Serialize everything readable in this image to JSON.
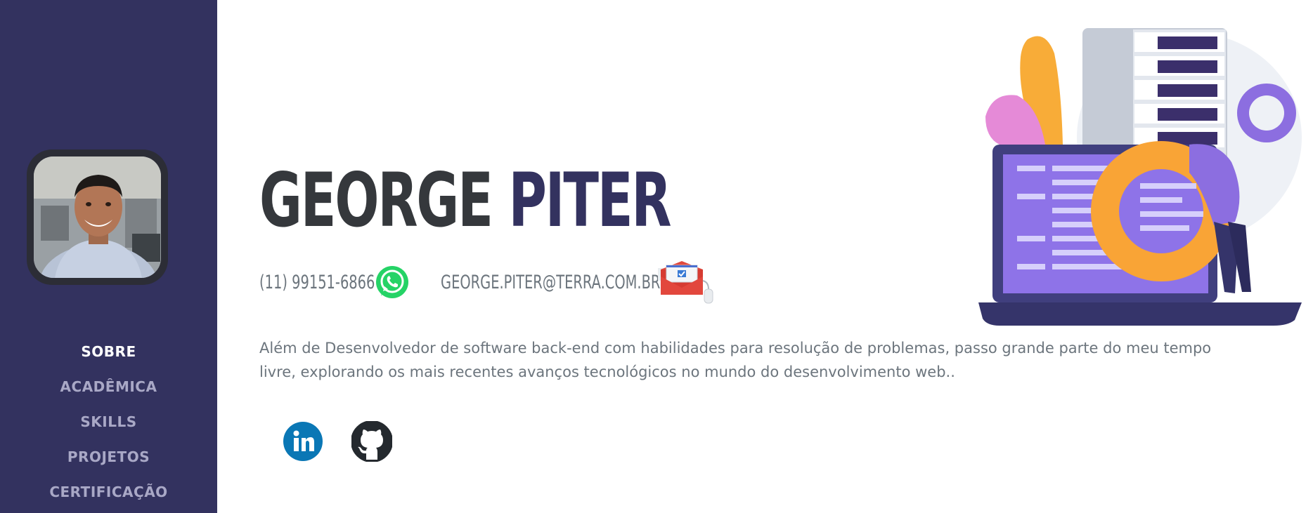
{
  "profile": {
    "first_name": "GEORGE",
    "last_name": "PITER",
    "phone": "(11) 99151-6866",
    "email": "GEORGE.PITER@TERRA.COM.BR",
    "about": "Além de Desenvolvedor de software back-end com habilidades para resolução de problemas, passo grande parte do meu tempo livre, explorando os mais recentes avanços tecnológicos no mundo do desenvolvimento web.."
  },
  "nav": {
    "items": [
      {
        "label": "SOBRE",
        "active": true
      },
      {
        "label": "ACADÊMICA",
        "active": false
      },
      {
        "label": "SKILLS",
        "active": false
      },
      {
        "label": "PROJETOS",
        "active": false
      },
      {
        "label": "CERTIFICAÇÃO",
        "active": false
      }
    ]
  },
  "icons": {
    "whatsapp": "whatsapp-icon",
    "email": "email-icon",
    "linkedin": "linkedin-icon",
    "github": "github-icon"
  },
  "colors": {
    "sidebar": "#33325f",
    "name_first": "#35383c",
    "name_last": "#33325f",
    "body_text": "#6c757d",
    "nav_inactive": "#a9a8c6",
    "nav_active": "#ffffff",
    "whatsapp": "#25d366",
    "linkedin": "#0a77b5",
    "github": "#24292e"
  }
}
